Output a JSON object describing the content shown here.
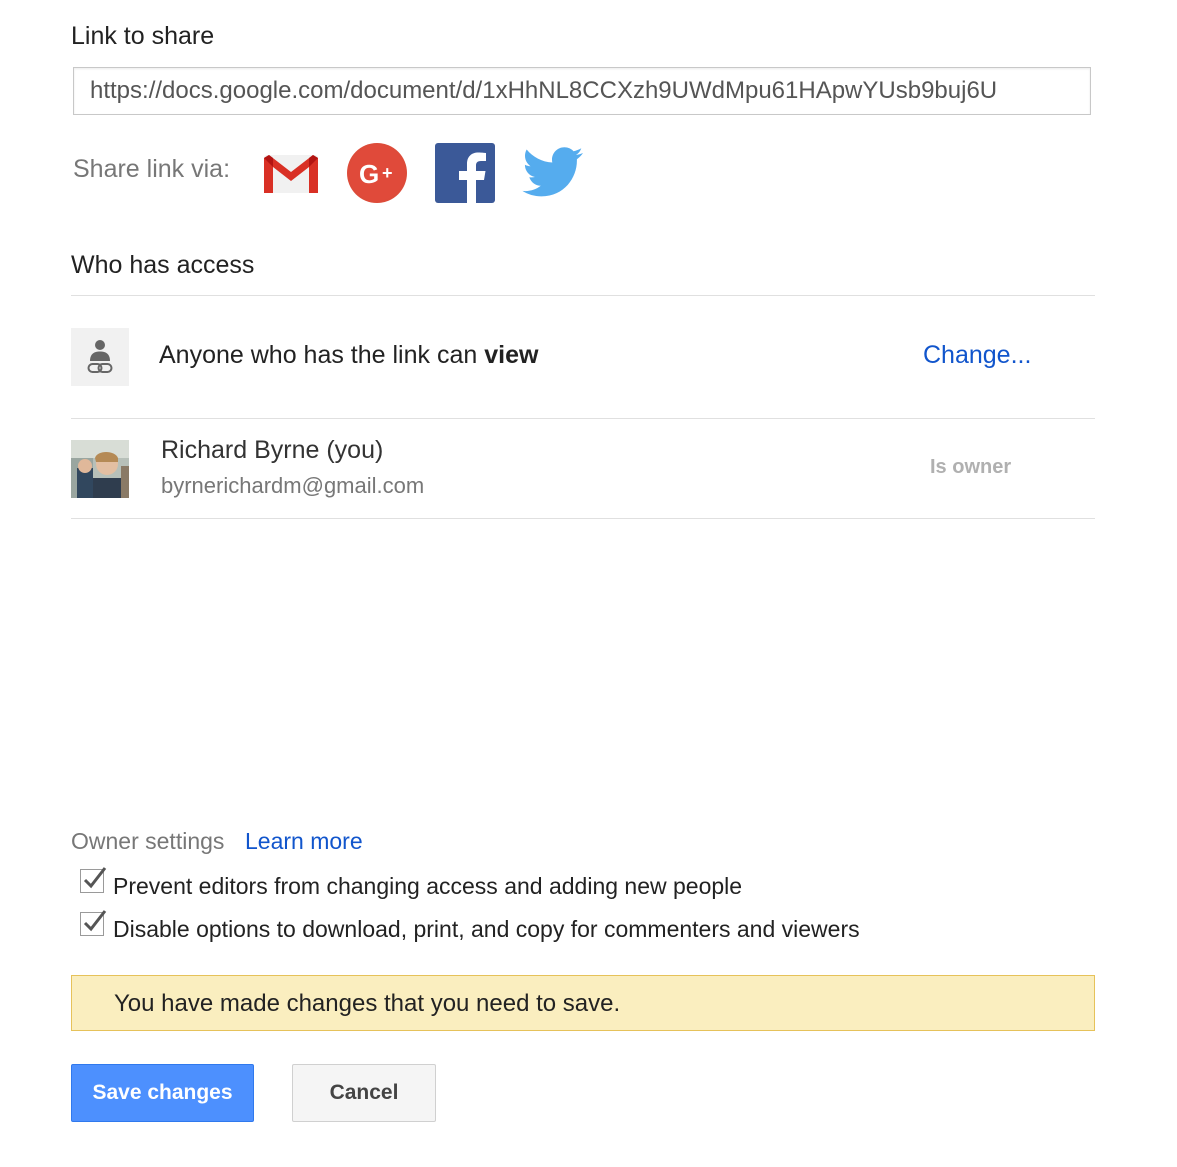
{
  "link_section": {
    "title": "Link to share",
    "url": "https://docs.google.com/document/d/1xHhNL8CCXzh9UWdMpu61HApwYUsb9buj6U"
  },
  "share": {
    "label": "Share link via:",
    "icons": [
      "gmail-icon",
      "google-plus-icon",
      "facebook-icon",
      "twitter-icon"
    ]
  },
  "access": {
    "title": "Who has access",
    "link_row": {
      "text_prefix": "Anyone who has the link can ",
      "permission": "view",
      "change_label": "Change..."
    },
    "owner_row": {
      "name": "Richard Byrne (you)",
      "email": "byrnerichardm@gmail.com",
      "role": "Is owner"
    }
  },
  "owner_settings": {
    "label": "Owner settings",
    "learn_more": "Learn more",
    "options": [
      {
        "label": "Prevent editors from changing access and adding new people",
        "checked": true
      },
      {
        "label": "Disable options to download, print, and copy for commenters and viewers",
        "checked": true
      }
    ]
  },
  "notice": {
    "text": "You have made changes that you need to save."
  },
  "buttons": {
    "save": "Save changes",
    "cancel": "Cancel"
  },
  "colors": {
    "link_blue": "#1155cc",
    "primary_button": "#4d90fe",
    "notice_bg": "#faeebf",
    "notice_border": "#e6c25a"
  }
}
